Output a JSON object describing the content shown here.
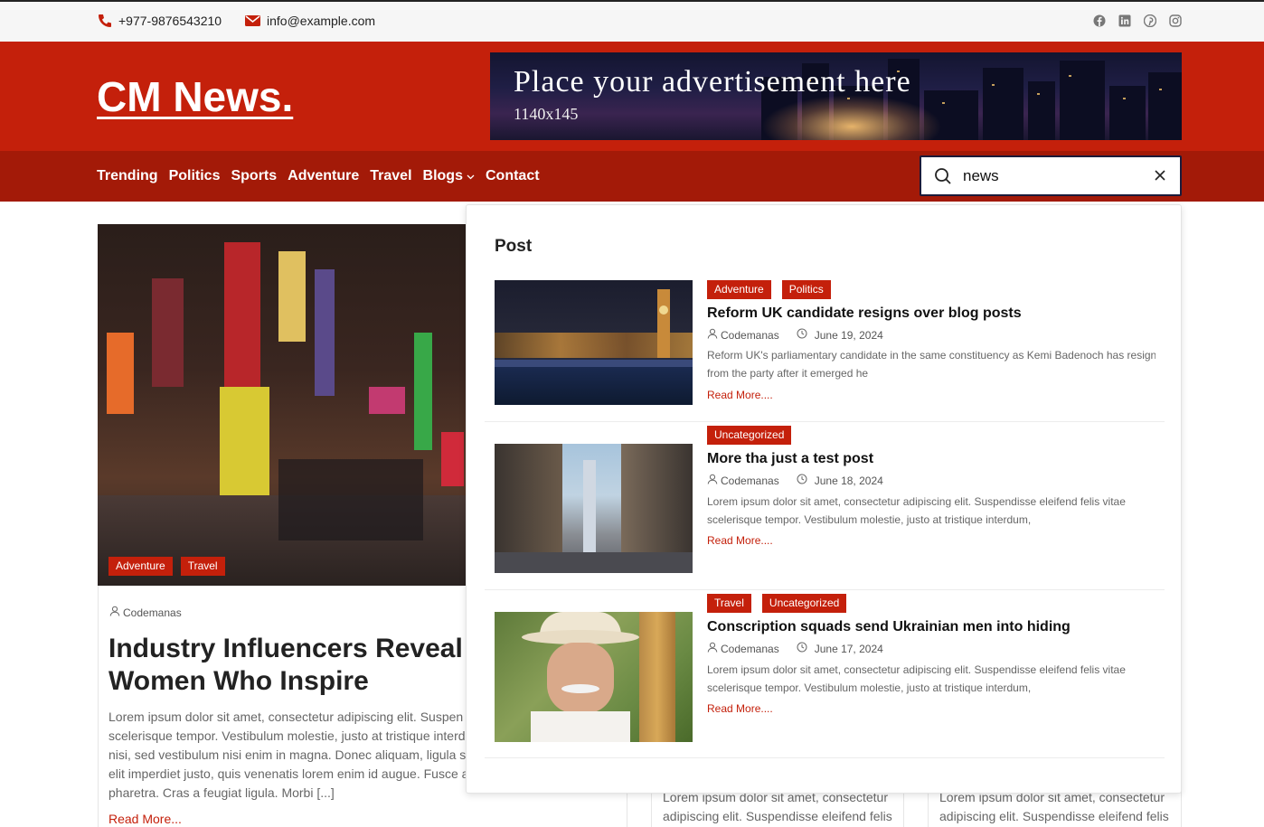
{
  "topbar": {
    "phone": "+977-9876543210",
    "email": "info@example.com",
    "socials": [
      "facebook-icon",
      "linkedin-icon",
      "pinterest-icon",
      "instagram-icon"
    ]
  },
  "header": {
    "logo": "CM News.",
    "ad_text": "Place your advertisement here",
    "ad_size": "1140x145"
  },
  "nav": {
    "items": [
      "Trending",
      "Politics",
      "Sports",
      "Adventure",
      "Travel",
      "Blogs",
      "Contact"
    ]
  },
  "search": {
    "value": "news"
  },
  "hero": {
    "tags": [
      "Adventure",
      "Travel"
    ],
    "author": "Codemanas",
    "title_line1": "Industry Influencers Reveal th",
    "title_line2": "Women Who Inspire",
    "excerpt": [
      "Lorem ipsum dolor sit amet, consectetur adipiscing elit. Suspen",
      "scelerisque tempor. Vestibulum molestie, justo at tristique interd",
      "nisi, sed vestibulum nisi enim in magna. Donec aliquam, ligula se",
      "elit imperdiet justo, quis venenatis lorem enim id augue. Fusce a",
      "pharetra. Cras a feugiat ligula. Morbi [...]"
    ],
    "read_more": "Read More..."
  },
  "side_cards": [
    {
      "line1": "Lorem ipsum dolor sit amet, consectetur",
      "line2": "adipiscing elit. Suspendisse eleifend felis"
    },
    {
      "line1": "Lorem ipsum dolor sit amet, consectetur",
      "line2": "adipiscing elit. Suspendisse eleifend felis"
    }
  ],
  "dropdown": {
    "heading": "Post",
    "results": [
      {
        "tags": [
          "Adventure",
          "Politics"
        ],
        "title": "Reform UK candidate resigns over blog posts",
        "author": "Codemanas",
        "date": "June 19, 2024",
        "excerpt_line1": "Reform UK's parliamentary candidate in the same constituency as Kemi Badenoch has resign",
        "excerpt_line2": "from the party after it emerged he",
        "read_more": "Read More...."
      },
      {
        "tags": [
          "Uncategorized"
        ],
        "title": "More tha just a test post",
        "author": "Codemanas",
        "date": "June 18, 2024",
        "excerpt_line1": "Lorem ipsum dolor sit amet, consectetur adipiscing elit. Suspendisse eleifend felis vitae",
        "excerpt_line2": "scelerisque tempor. Vestibulum molestie, justo at tristique interdum,",
        "read_more": "Read More...."
      },
      {
        "tags": [
          "Travel",
          "Uncategorized"
        ],
        "title": "Conscription squads send Ukrainian men into hiding",
        "author": "Codemanas",
        "date": "June 17, 2024",
        "excerpt_line1": "Lorem ipsum dolor sit amet, consectetur adipiscing elit. Suspendisse eleifend felis vitae",
        "excerpt_line2": "scelerisque tempor. Vestibulum molestie, justo at tristique interdum,",
        "read_more": "Read More...."
      }
    ]
  }
}
